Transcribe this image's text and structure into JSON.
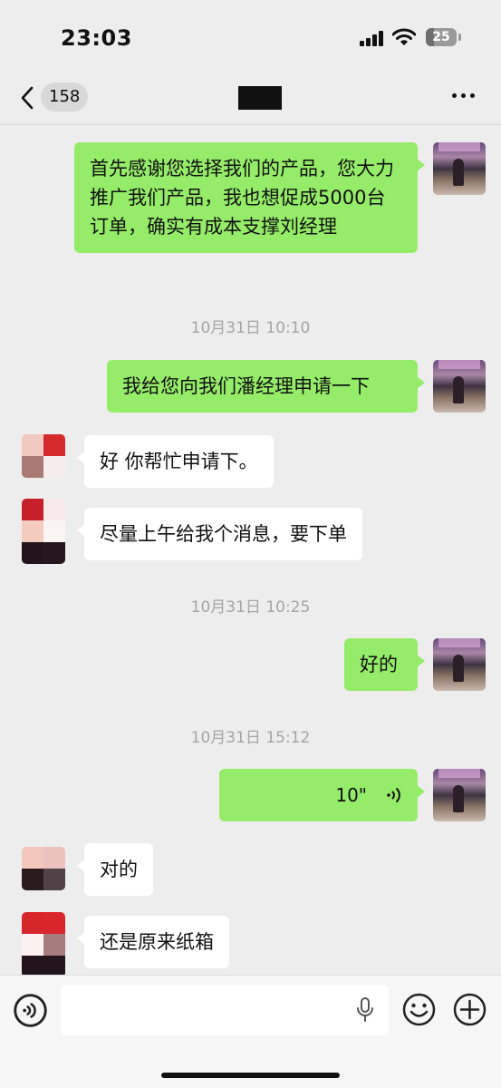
{
  "status_bar": {
    "time": "23:03",
    "battery": "25",
    "battery_level": 0.25
  },
  "nav": {
    "unread_count": "158"
  },
  "messages": [
    {
      "side": "me",
      "text": "首先感谢您选择我们的产品，您大力推广我们产品，我也想促成5000台订单，确实有成本支撑刘经理"
    },
    {
      "type": "timestamp",
      "text": "10月31日 10:10"
    },
    {
      "side": "me",
      "text": "我给您向我们潘经理申请一下"
    },
    {
      "side": "them",
      "text": "好 你帮忙申请下。"
    },
    {
      "side": "them",
      "text": "尽量上午给我个消息，要下单"
    },
    {
      "type": "timestamp",
      "text": "10月31日 10:25"
    },
    {
      "side": "me",
      "text": "好的"
    },
    {
      "type": "timestamp",
      "text": "10月31日 15:12"
    },
    {
      "side": "me",
      "type": "voice",
      "duration": "10\"",
      "icon": "voice-wave-icon"
    },
    {
      "side": "them",
      "text": "对的"
    },
    {
      "side": "them",
      "text": "还是原来纸箱"
    }
  ],
  "input_bar": {
    "placeholder": "",
    "icons": [
      "voice-mode-icon",
      "microphone-icon",
      "emoji-icon",
      "plus-icon"
    ]
  }
}
